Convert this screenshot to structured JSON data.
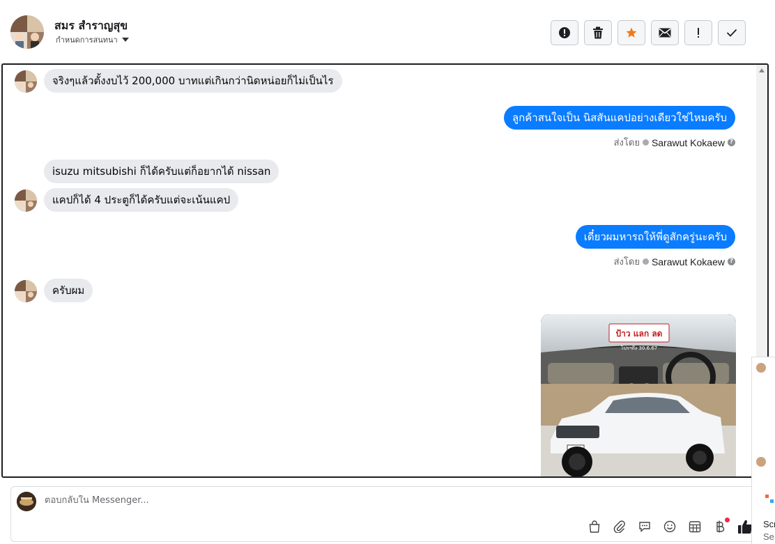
{
  "header": {
    "contact_name": "สมร สำราญสุข",
    "assign_label": "กำหนดการสนทนา"
  },
  "actions": [
    {
      "name": "report-icon",
      "glyph": "!"
    },
    {
      "name": "trash-icon",
      "glyph": "trash"
    },
    {
      "name": "star-icon",
      "glyph": "star",
      "color": "#f07b1d"
    },
    {
      "name": "mail-icon",
      "glyph": "mail"
    },
    {
      "name": "exclamation-icon",
      "glyph": "!"
    },
    {
      "name": "check-icon",
      "glyph": "check"
    }
  ],
  "messages": [
    {
      "dir": "in",
      "text": "จริงๆแล้วตั้งงบไว้ 200,000 บาทแต่เกินกว่านิดหน่อยก็ไม่เป็นไร"
    },
    {
      "dir": "out",
      "text": "ลูกค้าสนใจเป็น นิสสันแคปอย่างเดียวใช่ไหมครับ",
      "sent_by_label": "ส่งโดย",
      "sender": "Sarawut Kokaew"
    },
    {
      "dir": "in",
      "text": "isuzu mitsubishi ก็ได้ครับแต่ก็อยากได้ nissan"
    },
    {
      "dir": "in",
      "text": "แคปก็ได้ 4 ประตูก็ได้ครับแต่จะเน้นแคป"
    },
    {
      "dir": "out",
      "text": "เดี๋ยวผมหารถให้พี่ดูสักครู่นะครับ",
      "sent_by_label": "ส่งโดย",
      "sender": "Sarawut Kokaew"
    },
    {
      "dir": "in",
      "text": "ครับผม"
    }
  ],
  "photo": {
    "sign_text": "ป้าว แลก ลด",
    "sign_sub": "โปรฯถึง 30.6.67"
  },
  "composer": {
    "placeholder": "ตอบกลับใน Messenger..."
  },
  "colors": {
    "outgoing": "#0a7cff",
    "incoming": "#e9eaed",
    "star": "#f07b1d",
    "notification": "#f02849"
  },
  "side_fragment": {
    "text_1": "Scr",
    "text_2": "Se"
  }
}
